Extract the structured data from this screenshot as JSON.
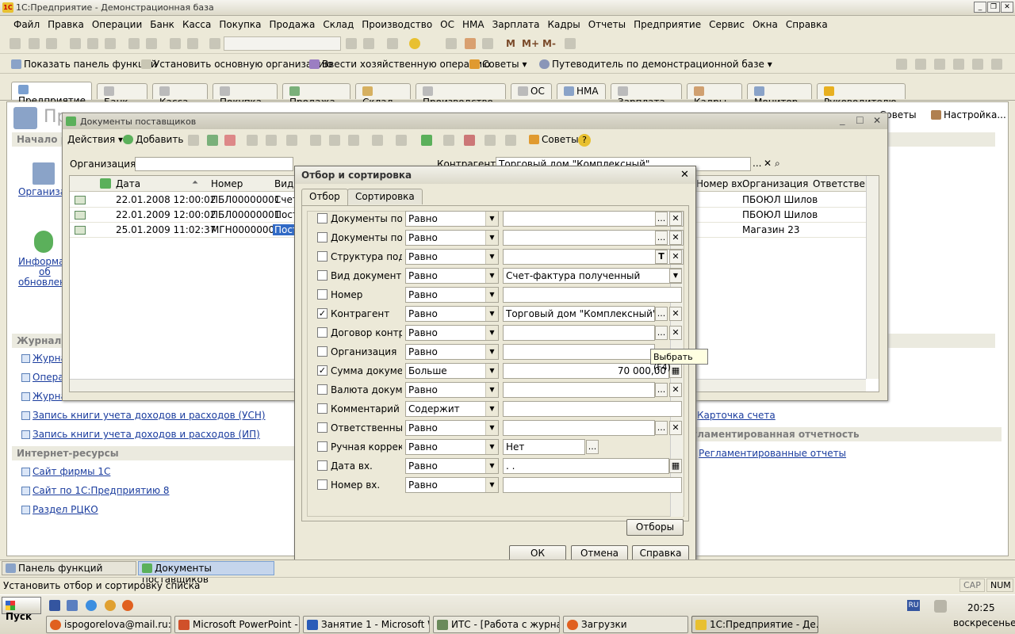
{
  "window": {
    "title": "1С:Предприятие - Демонстрационная база"
  },
  "menu": [
    "Файл",
    "Правка",
    "Операции",
    "Банк",
    "Касса",
    "Покупка",
    "Продажа",
    "Склад",
    "Производство",
    "ОС",
    "НМА",
    "Зарплата",
    "Кадры",
    "Отчеты",
    "Предприятие",
    "Сервис",
    "Окна",
    "Справка"
  ],
  "toolbar2": {
    "show_panel": "Показать панель функций",
    "set_org": "Установить основную организацию",
    "enter_op": "Ввести хозяйственную операцию",
    "tips": "Советы",
    "guide": "Путеводитель по демонстрационной базе"
  },
  "tabs": [
    "Предприятие",
    "Банк",
    "Касса",
    "Покупка",
    "Продажа",
    "Склад",
    "Производство",
    "ОС",
    "НМА",
    "Зарплата",
    "Кадры",
    "Монитор",
    "Руководителю"
  ],
  "panel": {
    "big_title": "Пр",
    "start": "Начало р",
    "tips": "Советы",
    "settings": "Настройка...",
    "org_link": "Организац",
    "info_link_1": "Информац",
    "info_link_2": "об",
    "info_link_3": "обновлен",
    "journals": "Журналы",
    "journal_link_1": "Журна",
    "journal_link_2": "Опера",
    "journal_link_3": "Журна",
    "book_usn": "Запись книги учета доходов и расходов (УСН)",
    "book_ip": "Запись книги учета доходов и расходов (ИП)",
    "internet": "Интернет-ресурсы",
    "site1": "Сайт фирмы 1С",
    "site2": "Сайт по 1С:Предприятию 8",
    "site3": "Раздел РЦКО",
    "card": "Карточка счета",
    "reg_section": "гламентированная отчетность",
    "reg_reports": "Регламентированные отчеты"
  },
  "docwin": {
    "title": "Документы поставщиков",
    "actions": "Действия",
    "add": "Добавить",
    "tips": "Советы",
    "org_label": "Организация:",
    "contr_label": "Контрагент:",
    "contr_value": "Торговый дом \"Комплексный\"",
    "columns": {
      "date": "Дата",
      "number": "Номер",
      "kind": "Вид д",
      "num_in": "Номер вх.",
      "org": "Организация",
      "resp": "Ответственн"
    },
    "rows": [
      {
        "date": "22.01.2008 12:00:02",
        "number": "ПБЛ00000001",
        "kind": "Счет-",
        "org": "ПБОЮЛ  Шилов"
      },
      {
        "date": "22.01.2009 12:00:02",
        "number": "ПБЛ00000001",
        "kind": "Пост",
        "org": "ПБОЮЛ  Шилов"
      },
      {
        "date": "25.01.2009 11:02:37",
        "number": "МГН00000001",
        "kind": "Пост",
        "org": "Магазин 23"
      }
    ]
  },
  "dialog": {
    "title": "Отбор и сортировка",
    "tab_filter": "Отбор",
    "tab_sort": "Сортировка",
    "rows": [
      {
        "checked": "",
        "label": "Документы по ...",
        "cmp": "Равно",
        "value": "",
        "btn1": "...",
        "btn2": "✕"
      },
      {
        "checked": "",
        "label": "Документы по ...",
        "cmp": "Равно",
        "value": "",
        "btn1": "...",
        "btn2": "✕"
      },
      {
        "checked": "",
        "label": "Структура подч...",
        "cmp": "Равно",
        "value": "",
        "btn1": "T",
        "btn2": "✕"
      },
      {
        "checked": "",
        "label": "Вид документа",
        "cmp": "Равно",
        "value": "Счет-фактура полученный",
        "btn1": "",
        "btn2": "▼"
      },
      {
        "checked": "",
        "label": "Номер",
        "cmp": "Равно",
        "value": "",
        "btn1": "",
        "btn2": ""
      },
      {
        "checked": "✓",
        "label": "Контрагент",
        "cmp": "Равно",
        "value": "Торговый дом \"Комплексный\"",
        "btn1": "...",
        "btn2": "✕"
      },
      {
        "checked": "",
        "label": "Договор контр...",
        "cmp": "Равно",
        "value": "",
        "btn1": "...",
        "btn2": "✕"
      },
      {
        "checked": "",
        "label": "Организация",
        "cmp": "Равно",
        "value": "",
        "btn1": "",
        "btn2": ""
      },
      {
        "checked": "✓",
        "label": "Сумма докуме...",
        "cmp": "Больше",
        "value": "70 000,00",
        "btn1": "",
        "btn2": "▦"
      },
      {
        "checked": "",
        "label": "Валюта докуме...",
        "cmp": "Равно",
        "value": "",
        "btn1": "...",
        "btn2": "✕"
      },
      {
        "checked": "",
        "label": "Комментарий",
        "cmp": "Содержит",
        "value": "",
        "btn1": "",
        "btn2": ""
      },
      {
        "checked": "",
        "label": "Ответственный",
        "cmp": "Равно",
        "value": "",
        "btn1": "...",
        "btn2": "✕"
      },
      {
        "checked": "",
        "label": "Ручная коррект...",
        "cmp": "Равно",
        "value": "Нет",
        "btn1": "...",
        "btn2": ""
      },
      {
        "checked": "",
        "label": "Дата вх.",
        "cmp": "Равно",
        "value": " .  .",
        "btn1": "",
        "btn2": "▦"
      },
      {
        "checked": "",
        "label": "Номер вх.",
        "cmp": "Равно",
        "value": "",
        "btn1": "",
        "btn2": ""
      }
    ],
    "filters_btn": "Отборы",
    "ok": "ОК",
    "cancel": "Отмена",
    "help": "Справка"
  },
  "tooltip": "Выбрать (F4)",
  "taskbar": {
    "panel": "Панель функций",
    "docs": "Документы поставщиков"
  },
  "status": {
    "text": "Установить отбор и сортировку списка",
    "cap": "CAP",
    "num": "NUM"
  },
  "win": {
    "start": "Пуск",
    "lang": "RU",
    "time": "20:25",
    "day": "воскресенье",
    "tasks": [
      "ispogorelova@mail.ru: О...",
      "Microsoft PowerPoint - [...",
      "Занятие 1 - Microsoft W...",
      "ИТС - [Работа с журнал...",
      "Загрузки",
      "1С:Предприятие - Де..."
    ]
  }
}
